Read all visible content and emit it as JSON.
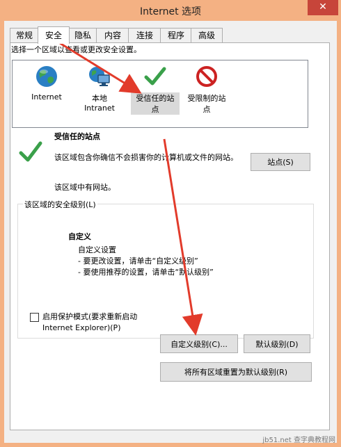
{
  "window": {
    "title": "Internet 选项",
    "close_symbol": "✕"
  },
  "tabs": [
    "常规",
    "安全",
    "隐私",
    "内容",
    "连接",
    "程序",
    "高级"
  ],
  "active_tab": "安全",
  "zones": {
    "instruction": "选择一个区域以查看或更改安全设置。",
    "items": [
      {
        "label": "Internet",
        "icon": "globe-icon"
      },
      {
        "label": "本地\nIntranet",
        "icon": "intranet-icon"
      },
      {
        "label": "受信任的站\n点",
        "icon": "check-icon"
      },
      {
        "label": "受限制的站\n点",
        "icon": "restricted-icon"
      }
    ],
    "selected": "受信任的站点"
  },
  "selected_zone": {
    "title": "受信任的站点",
    "description": "该区域包含你确信不会损害你的计算机或文件的网站。",
    "note": "该区域中有网站。",
    "sites_button": "站点(S)"
  },
  "security_level": {
    "group_label": "该区域的安全级别(L)",
    "level_name": "自定义",
    "level_desc": [
      "自定义设置",
      "- 要更改设置，请单击“自定义级别”",
      "- 要使用推荐的设置，请单击“默认级别”"
    ],
    "protected_mode_label": "启用保护模式(要求重新启动 Internet Explorer)(P)",
    "custom_level_button": "自定义级别(C)...",
    "default_level_button": "默认级别(D)",
    "reset_all_button": "将所有区域重置为默认级别(R)"
  },
  "colors": {
    "title_bar": "#f4b183",
    "annotation_arrow": "#e23b2b",
    "close_button": "#c7453a"
  },
  "watermark": "jb51.net 查字典教程网"
}
